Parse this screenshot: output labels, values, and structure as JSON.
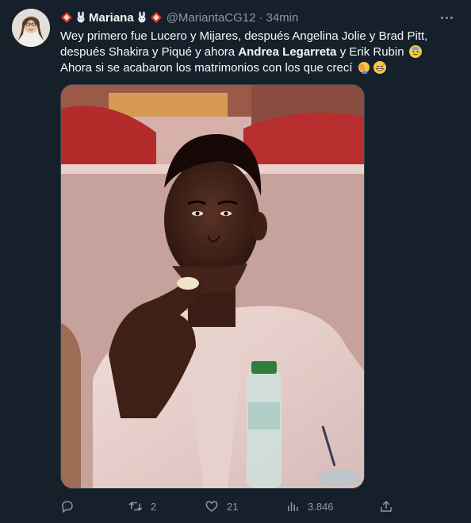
{
  "tweet": {
    "display_name": "Mariana",
    "handle": "@MariantaCG12",
    "separator": "·",
    "time": "34min",
    "text_part1": "Wey primero fue Lucero y Mijares, después Angelina Jolie y Brad Pitt, después Shakira y Piqué y ahora ",
    "text_bold": "Andrea Legarreta",
    "text_part2": " y Erik Rubin ",
    "text_part3": " Ahora si se acabaron los matrimonios con los que crecí ",
    "emojis": [
      "diamond-icon",
      "bunny-icon",
      "sweat-face-emoji",
      "facepalm-emoji",
      "grin-sweat-emoji"
    ]
  },
  "actions": {
    "reply_count": "",
    "retweet_count": "2",
    "like_count": "21",
    "views_count": "3.846"
  },
  "colors": {
    "background": "#15202b",
    "text": "#f7f9f9",
    "muted": "#8b98a5",
    "border": "#38444d"
  }
}
